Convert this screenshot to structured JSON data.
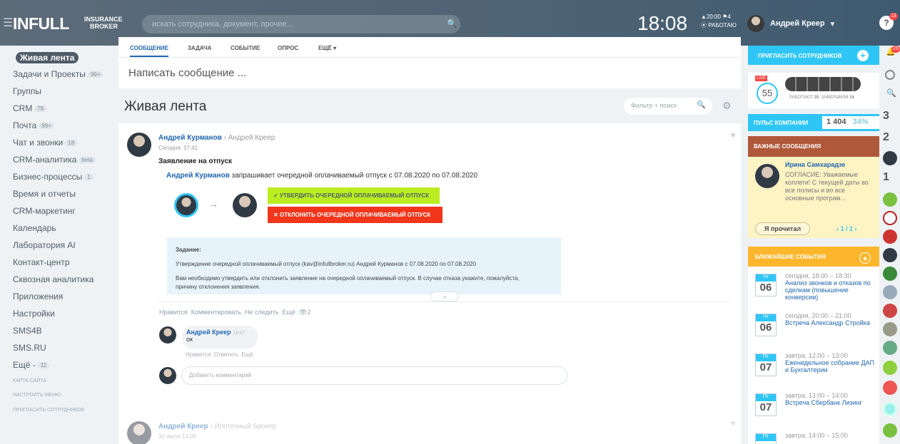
{
  "topbar": {
    "logo": "INFULL",
    "logo_sub1": "INSURANCE",
    "logo_sub2": "BROKER",
    "search_placeholder": "искать сотрудника, документ, прочее...",
    "clock": "18:08",
    "time_small": "▲20:00  ⚑4",
    "status": "⦿ РАБОТАЮ",
    "user_name": "Андрей Креер",
    "help": "?",
    "help_badge": "13"
  },
  "sidebar": {
    "items": [
      {
        "label": "Живая лента",
        "count": ""
      },
      {
        "label": "Задачи и Проекты",
        "count": "99+"
      },
      {
        "label": "Группы",
        "count": ""
      },
      {
        "label": "CRM",
        "count": "78"
      },
      {
        "label": "Почта",
        "count": "99+"
      },
      {
        "label": "Чат и звонки",
        "count": "18"
      },
      {
        "label": "CRM-аналитика",
        "count": "beta"
      },
      {
        "label": "Бизнес-процессы",
        "count": "1"
      },
      {
        "label": "Время и отчеты",
        "count": ""
      },
      {
        "label": "CRM-маркетинг",
        "count": ""
      },
      {
        "label": "Календарь",
        "count": ""
      },
      {
        "label": "Лаборатория AI",
        "count": ""
      },
      {
        "label": "Контакт-центр",
        "count": ""
      },
      {
        "label": "Сквозная аналитика",
        "count": ""
      },
      {
        "label": "Приложения",
        "count": ""
      },
      {
        "label": "Настройки",
        "count": ""
      },
      {
        "label": "SMS4B",
        "count": ""
      },
      {
        "label": "SMS.RU",
        "count": ""
      },
      {
        "label": "Ещё -",
        "count": "11"
      }
    ],
    "sitemap": "КАРТА САЙТА",
    "config": "НАСТРОИТЬ МЕНЮ",
    "invite": "ПРИГЛАСИТЬ СОТРУДНИКОВ"
  },
  "composer": {
    "tabs": [
      "СООБЩЕНИЕ",
      "ЗАДАЧА",
      "СОБЫТИЕ",
      "ОПРОС",
      "ЕЩЁ ▾"
    ],
    "placeholder": "Написать сообщение ..."
  },
  "feed": {
    "title": "Живая лента",
    "filter_placeholder": "Фильтр + поиск"
  },
  "post": {
    "author": "Андрей Курманов",
    "recipient": "Андрей Креер",
    "date": "Сегодня, 17:41",
    "title": "Заявление на отпуск",
    "body_author": "Андрей Курманов",
    "body_text": "запрашивает очередной оплачиваемый отпуск с 07.08.2020 по 07.08.2020",
    "approve": "✓  УТВЕРДИТЬ ОЧЕРЕДНОЙ ОПЛАЧИВАЕМЫЙ ОТПУСК",
    "reject": "✕  ОТКЛОНИТЬ ОЧЕРЕДНОЙ ОПЛАЧИВАЕМЫЙ ОТПУСК",
    "task_label": "Задание:",
    "task_line1": "Утверждение очередной оплачиваемый отпуск (kav@infullbroker.ru) Андрей Курманов с 07.08.2020 по 07.08.2020",
    "task_line2": "Вам необходимо утвердить или отклонить заявление на очередной оплачиваемый отпуск. В случае отказа укажите, пожалуйста,",
    "task_line3": "причину отклонения заявления.",
    "like": "Нравится",
    "comment": "Комментировать",
    "unfollow": "Не следить",
    "more": "Ещё",
    "views": "👁2",
    "comment_author": "Андрей Креер",
    "comment_time": "18:07",
    "comment_text": "ок",
    "c_like": "Нравится",
    "c_reply": "Ответить",
    "c_more": "Ещё",
    "add_comment": "Добавить комментарий"
  },
  "post2": {
    "author": "Андрей Креер",
    "recipient": "Ипотечный брокер",
    "date": "30 июля 14:08"
  },
  "right": {
    "invite": "ПРИГЛАСИТЬ СОТРУДНИКОВ",
    "live": "LIVE",
    "online": "55",
    "working_label": "РАБОТАЮТ",
    "working": "35",
    "finished_label": "ЗАВЕРШИЛИ",
    "finished": "14",
    "pulse": "ПУЛЬС КОМПАНИИ",
    "pulse_value": "1 404",
    "pulse_pct": "34%",
    "important": "ВАЖНЫЕ СООБЩЕНИЯ",
    "imp_author": "Ирина Самхарадзе",
    "imp_text": "СОГЛАСИЕ: Уважаемые коллеги! С текущей даты во все полисы и во все основные програм...",
    "read_btn": "Я прочитал",
    "pager": "‹  1 / 1  ›",
    "events": "БЛИЖАЙШИЕ СОБЫТИЯ",
    "event_list": [
      {
        "day": "Чт",
        "num": "06",
        "time": "сегодня, 18:00 – 18:30",
        "title": "Анализ звонков и отказов по сделкам (повышение конверсии)"
      },
      {
        "day": "Чт",
        "num": "06",
        "time": "сегодня, 20:00 – 21:00",
        "title": "Встреча Александр Стройка"
      },
      {
        "day": "Пт",
        "num": "07",
        "time": "завтра, 12:00 – 13:00",
        "title": "Еженедельное собрание ДАП и Бухгалтерии"
      },
      {
        "day": "Пт",
        "num": "07",
        "time": "завтра, 13:00 – 14:00",
        "title": "Встреча Сбербанк Лизинг"
      },
      {
        "day": "Пт",
        "num": "",
        "time": "завтра, 14:00 – 15:00",
        "title": ""
      }
    ]
  },
  "rail": {
    "bell_badge": "25",
    "counts": [
      "3",
      "2",
      "1"
    ]
  }
}
